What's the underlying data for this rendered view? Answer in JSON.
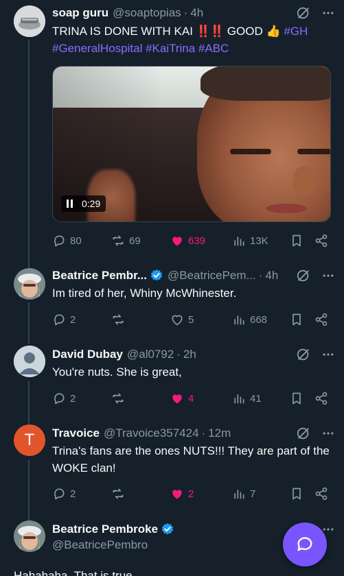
{
  "accent_color": "#1d9bf0",
  "hashtag_color": "#8b6cff",
  "like_color": "#f91880",
  "posts": [
    {
      "name": "soap guru",
      "handle": "@soaptopias",
      "time": "4h",
      "text_main": "TRINA IS DONE WITH KAI",
      "text_bang": "‼️‼️",
      "text_good": "GOOD",
      "emoji": "👍",
      "hashtag_inline": "#GH",
      "hashtags_line2": "#GeneralHospital #KaiTrina #ABC",
      "video_time": "0:29",
      "replies": "80",
      "reposts": "69",
      "likes": "639",
      "views": "13K"
    },
    {
      "name": "Beatrice Pembr...",
      "handle": "@BeatricePem...",
      "time": "4h",
      "text": "Im tired of her, Whiny McWhinester.",
      "replies": "2",
      "reposts": "",
      "likes": "5",
      "views": "668"
    },
    {
      "name": "David Dubay",
      "handle": "@al0792",
      "time": "2h",
      "text": "You're nuts. She is great,",
      "replies": "2",
      "reposts": "",
      "likes": "4",
      "views": "41"
    },
    {
      "name": "Travoice",
      "handle": "@Travoice357424",
      "time": "12m",
      "avatar_letter": "T",
      "text": "Trina's fans are the ones NUTS!!! They are part of the WOKE clan!",
      "replies": "2",
      "reposts": "",
      "likes": "2",
      "views": "7"
    },
    {
      "name": "Beatrice Pembroke",
      "handle": "@BeatricePembro",
      "text": "Hahahaha. That is true."
    }
  ]
}
